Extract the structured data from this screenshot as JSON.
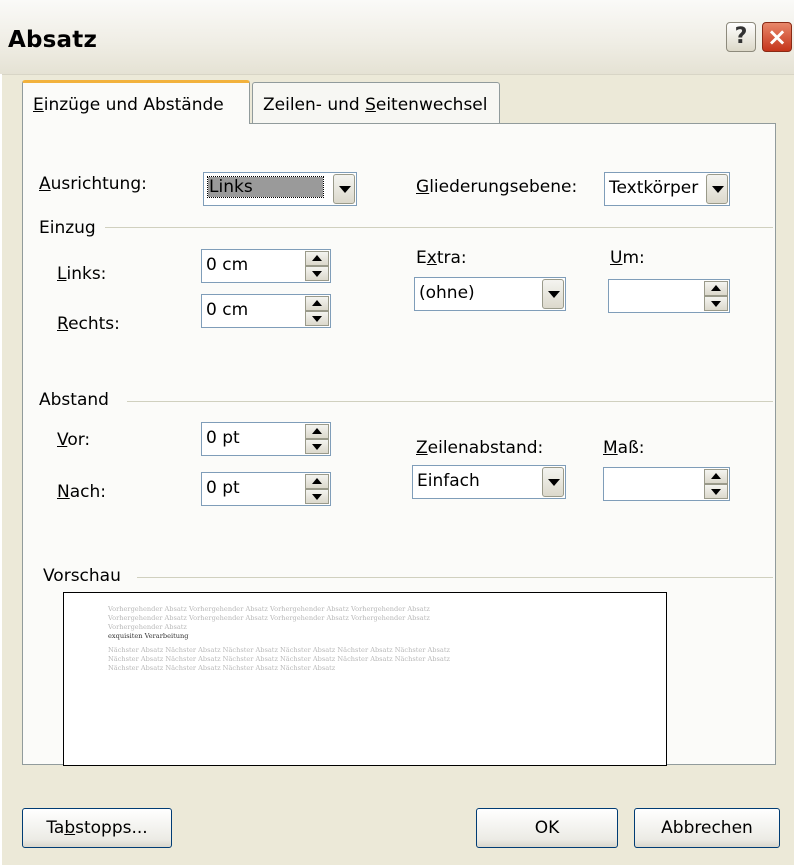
{
  "window": {
    "title": "Absatz",
    "help_label": "?",
    "close_label": "×"
  },
  "tabs": [
    {
      "label": "Einzüge und Abstände",
      "active": true
    },
    {
      "label": "Zeilen- und Seitenwechsel",
      "active": false
    }
  ],
  "general": {
    "alignment_label": "Ausrichtung:",
    "alignment_value": "Links",
    "outline_label": "Gliederungsebene:",
    "outline_value": "Textkörper"
  },
  "indent": {
    "group_label": "Einzug",
    "left_label": "Links:",
    "left_value": "0 cm",
    "right_label": "Rechts:",
    "right_value": "0 cm",
    "special_label": "Extra:",
    "special_value": "(ohne)",
    "by_label": "Um:",
    "by_value": ""
  },
  "spacing": {
    "group_label": "Abstand",
    "before_label": "Vor:",
    "before_value": "0 pt",
    "after_label": "Nach:",
    "after_value": "0 pt",
    "line_spacing_label": "Zeilenabstand:",
    "line_spacing_value": "Einfach",
    "at_label": "Maß:",
    "at_value": ""
  },
  "preview": {
    "group_label": "Vorschau",
    "lines": [
      "Vorhergehender Absatz Vorhergehender Absatz Vorhergehender Absatz Vorhergehender Absatz",
      "Vorhergehender Absatz Vorhergehender Absatz Vorhergehender Absatz Vorhergehender Absatz",
      "Vorhergehender Absatz",
      "exquisiten Verarbeitung",
      "Nächster Absatz Nächster Absatz Nächster Absatz Nächster Absatz Nächster Absatz Nächster Absatz",
      "Nächster Absatz Nächster Absatz Nächster Absatz Nächster Absatz Nächster Absatz Nächster Absatz",
      "Nächster Absatz Nächster Absatz Nächster Absatz Nächster Absatz"
    ]
  },
  "buttons": {
    "tabs_label": "Tabstopps...",
    "ok_label": "OK",
    "cancel_label": "Abbrechen"
  },
  "colors": {
    "dialog_bg": "#ece9d8",
    "tab_accent": "#f2b23d",
    "close_red": "#c5341b",
    "selection_gray": "#9a9a9a"
  }
}
